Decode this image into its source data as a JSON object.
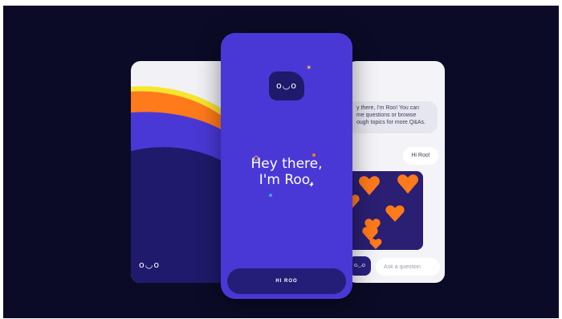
{
  "colors": {
    "background": "#0b0b27",
    "brand_purple": "#4a38d6",
    "deep_navy": "#1f1a6b",
    "accent_orange": "#ff7a1a",
    "accent_yellow": "#f7e52e"
  },
  "left_screen": {
    "logo": "o◡o"
  },
  "center_screen": {
    "logo": "o◡o",
    "headline_line1": "Hey there,",
    "headline_line2": "I'm Roo.",
    "cta_label": "HI ROO"
  },
  "right_screen": {
    "roo_message_line1": "y there, I'm Roo! You can",
    "roo_message_line2": "me questions or browse",
    "roo_message_line3": "ough topics for more Q&As.",
    "user_message": "Hi Roo!",
    "mini_avatar": "o◡o",
    "input_placeholder": "Ask a question"
  }
}
